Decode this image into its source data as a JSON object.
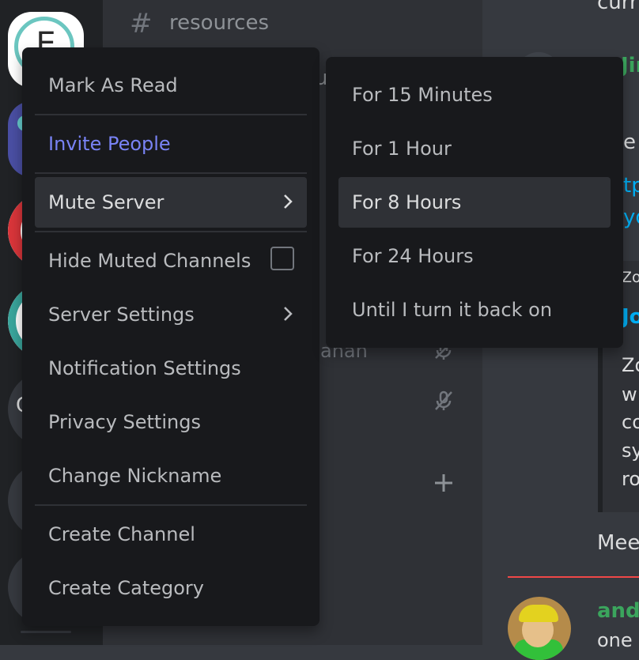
{
  "servers": {
    "initial": "E",
    "partial_letter": "C"
  },
  "channel": {
    "hash": "#",
    "name": "resources",
    "peek_letter": "u",
    "peek_member": "ahan"
  },
  "chat": {
    "top_text": "curr",
    "name1": "Jim",
    "frag_e": "e",
    "link1": "tp",
    "link2": "yd",
    "author_small": "Zo",
    "embed_title": "Jo",
    "embed_lines": [
      "Zo",
      "w",
      "co",
      "sy",
      "ro"
    ],
    "meet": "Mee",
    "user_name": "andr",
    "user_msg": "one"
  },
  "context_menu": {
    "items": [
      {
        "label": "Mark As Read",
        "accent": false
      },
      {
        "label": "Invite People",
        "accent": true
      },
      {
        "label": "Mute Server",
        "has_submenu": true,
        "hovered": true
      },
      {
        "label": "Hide Muted Channels",
        "checkbox": true,
        "checked": false
      },
      {
        "label": "Server Settings",
        "has_submenu": true
      },
      {
        "label": "Notification Settings"
      },
      {
        "label": "Privacy Settings"
      },
      {
        "label": "Change Nickname"
      },
      {
        "label": "Create Channel"
      },
      {
        "label": "Create Category"
      }
    ]
  },
  "mute_submenu": {
    "items": [
      {
        "label": "For 15 Minutes"
      },
      {
        "label": "For 1 Hour"
      },
      {
        "label": "For 8 Hours",
        "hovered": true
      },
      {
        "label": "For 24 Hours"
      },
      {
        "label": "Until I turn it back on"
      }
    ]
  },
  "colors": {
    "accent": "#7983f5",
    "menu_bg": "#18191c",
    "hover_bg": "#2f3136",
    "link": "#00aff4",
    "username_green": "#3ba55d",
    "unread_line": "#f04747"
  }
}
